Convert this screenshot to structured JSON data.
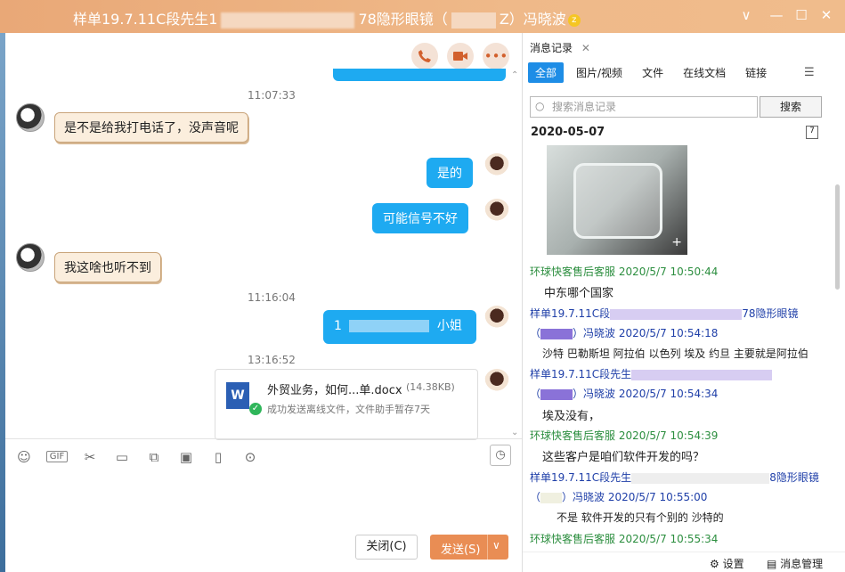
{
  "window": {
    "title_prefix": "样单19.7.11C段先生1",
    "title_middle": "78隐形眼镜（",
    "title_suffix": "Z）冯晓波",
    "minimize_glyph": "—",
    "chevron_glyph": "∨",
    "maximize_glyph": "☐",
    "close_glyph": "✕"
  },
  "chat": {
    "call_icon": "phone-icon",
    "video_icon": "video-icon",
    "more_icon": "more-icon",
    "times": [
      "11:07:33",
      "11:16:04",
      "13:16:52"
    ],
    "messages": [
      {
        "side": "left",
        "text": "是不是给我打电话了，没声音呢"
      },
      {
        "side": "right",
        "text": "是的"
      },
      {
        "side": "right",
        "text": "可能信号不好"
      },
      {
        "side": "left",
        "text": "我这啥也听不到"
      },
      {
        "side": "right",
        "text": "1",
        "text2": "小姐"
      }
    ],
    "file": {
      "name": "外贸业务，如何...单.docx",
      "size": "(14.38KB)",
      "status": "成功发送离线文件，文件助手暂存7天",
      "icon_letter": "W"
    },
    "toolbar_icons": [
      "emoji-icon",
      "gif-icon",
      "scissors-icon",
      "folder-icon",
      "image-doc-icon",
      "picture-icon",
      "shake-icon",
      "more-circle-icon"
    ],
    "close_button": "关闭(C)",
    "send_button": "发送(S)"
  },
  "history": {
    "tab_label": "消息记录",
    "filters": [
      "全部",
      "图片/视频",
      "文件",
      "在线文档",
      "链接"
    ],
    "search_placeholder": "搜索消息记录",
    "search_button": "搜索",
    "date": "2020-05-07",
    "entries": [
      {
        "sender": "环球快客售后客服 2020/5/7 10:50:44",
        "type": "g",
        "text": "中东哪个国家"
      },
      {
        "sender": "样单19.7.11C段",
        "sender_end": "78隐形眼镜",
        "sender2": "）冯晓波 2020/5/7 10:54:18",
        "type": "b",
        "text": "沙特 巴勒斯坦 阿拉伯  以色列 埃及 约旦 主要就是阿拉伯"
      },
      {
        "sender": "样单19.7.11C段先生",
        "sender_end": "",
        "sender2": "）冯晓波 2020/5/7 10:54:34",
        "type": "b",
        "text": "埃及没有，"
      },
      {
        "sender": "环球快客售后客服 2020/5/7 10:54:39",
        "type": "g",
        "text": "这些客户是咱们软件开发的吗？"
      },
      {
        "sender": "样单19.7.11C段先生",
        "sender_end": "8隐形眼镜",
        "sender2": "）冯晓波 2020/5/7 10:55:00",
        "type": "b",
        "text": "不是 软件开发的只有个别的 沙特的"
      },
      {
        "sender": "环球快客售后客服 2020/5/7 10:55:34",
        "type": "g",
        "text": ""
      }
    ],
    "settings_label": "设置",
    "manage_label": "消息管理"
  }
}
